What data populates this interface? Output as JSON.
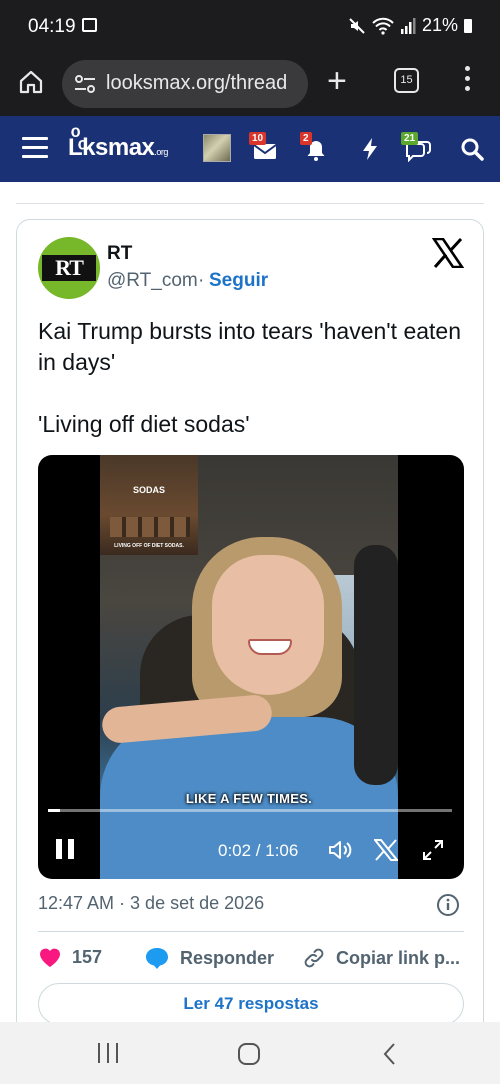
{
  "status_bar": {
    "time": "04:19",
    "battery": "21%",
    "icons": [
      "gallery-icon",
      "mute-icon",
      "wifi-icon",
      "signal-icon",
      "battery-icon"
    ]
  },
  "browser": {
    "url": "looksmax.org/thread",
    "tab_count": "15",
    "icons": [
      "home-icon",
      "site-settings-icon",
      "new-tab-icon",
      "tab-switcher-icon",
      "menu-icon"
    ]
  },
  "site_header": {
    "logo_main": "Lͦͦksmax",
    "logo_suffix": ".org",
    "badges": {
      "messages": "10",
      "alerts": "2",
      "inbox": "21"
    },
    "icons": [
      "hamburger-icon",
      "avatar-image",
      "envelope-icon",
      "bell-icon",
      "lightning-icon",
      "chat-icon",
      "search-icon"
    ]
  },
  "tweet": {
    "account_name": "RT",
    "avatar_text": "RT",
    "handle": "@RT_com",
    "separator": "·",
    "follow_label": "Seguir",
    "text_line1": "Kai Trump bursts into tears 'haven't eaten in days'",
    "text_line2": "'Living off diet sodas'",
    "video": {
      "inset_tag": "SODAS",
      "inset_caption": "LIVING OFF OF DIET SODAS.",
      "subtitle": "LIKE A FEW TIMES.",
      "time_display": "0:02 / 1:06",
      "progress_fraction": 0.03
    },
    "timestamp": "12:47 AM · 3 de set de 2026",
    "like_count": "157",
    "reply_label": "Responder",
    "copy_link_label": "Copiar link p...",
    "read_replies_label": "Ler 47 respostas"
  },
  "colors": {
    "site_header_bg": "#1b3176",
    "rt_green": "#76b82a",
    "link_blue": "#1d73c8",
    "heart_pink": "#f91880",
    "badge_red": "#d9352a",
    "badge_green": "#5aa82e"
  }
}
